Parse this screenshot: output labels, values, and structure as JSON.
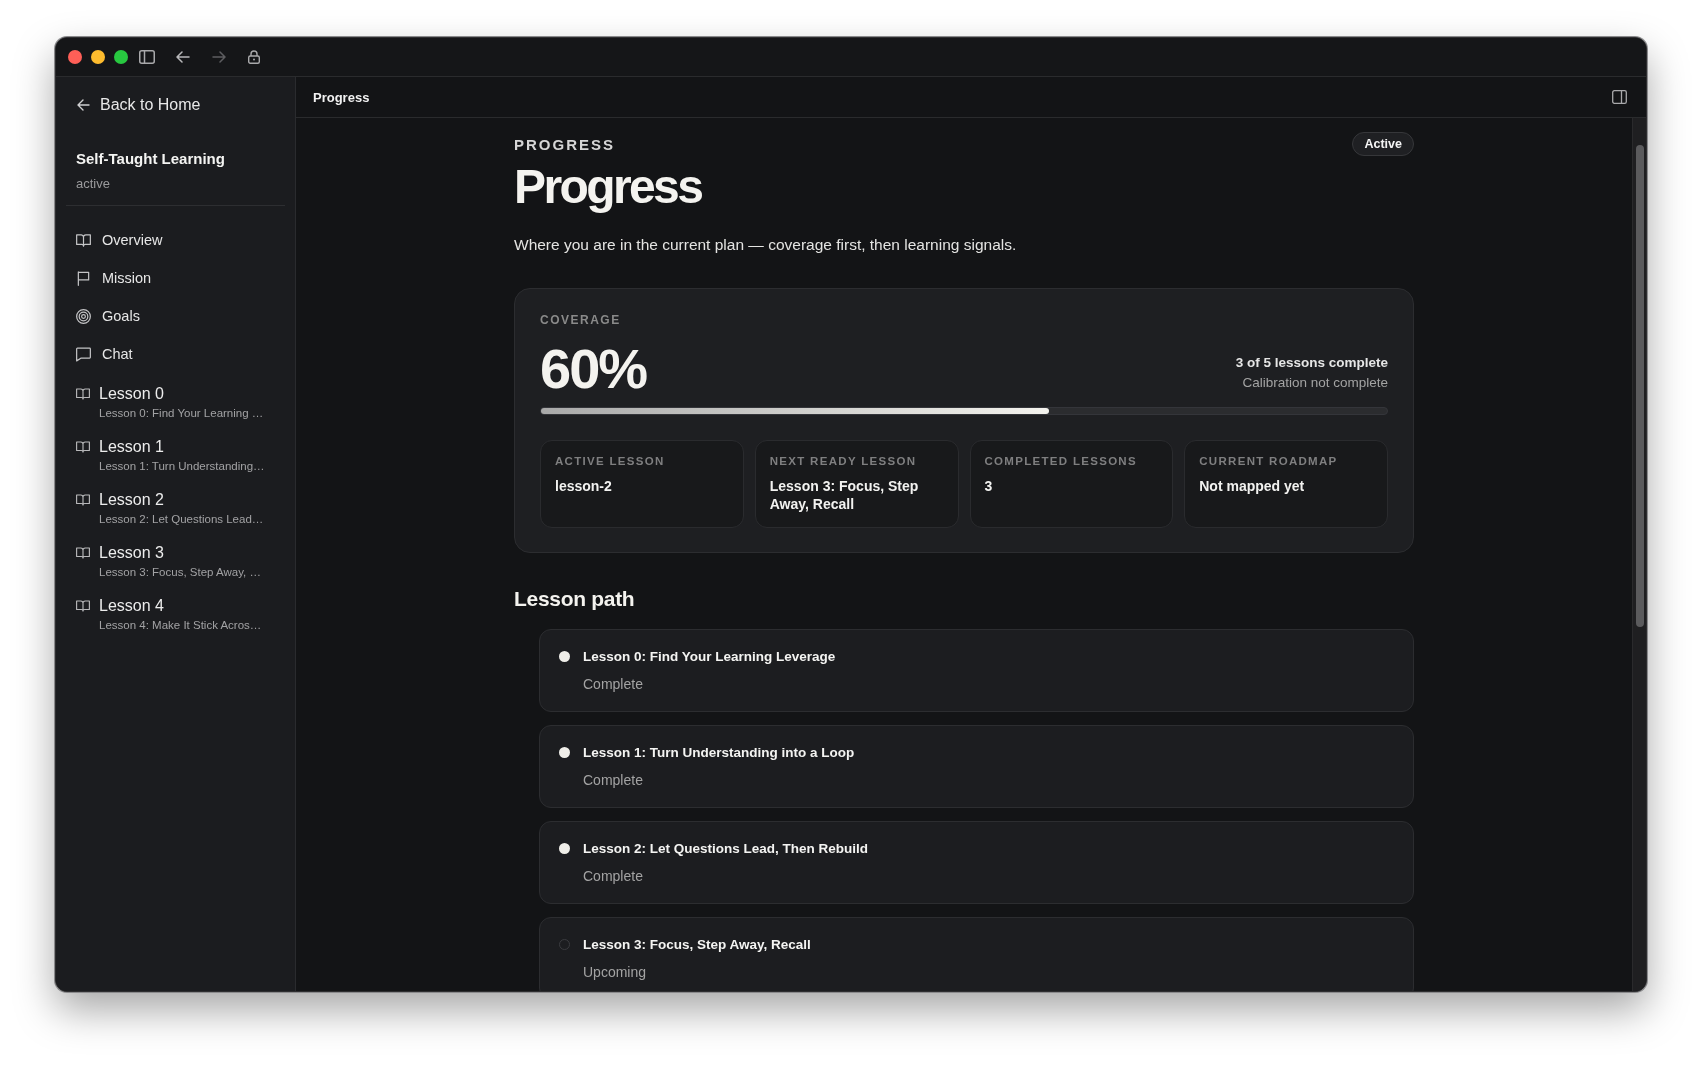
{
  "sidebar": {
    "back_link": "Back to Home",
    "project": {
      "title": "Self-Taught Learning",
      "status": "active"
    },
    "nav_items": [
      {
        "label": "Overview",
        "kind": "overview"
      },
      {
        "label": "Mission",
        "kind": "mission"
      },
      {
        "label": "Goals",
        "kind": "goals"
      },
      {
        "label": "Chat",
        "kind": "chat"
      }
    ],
    "lessons": [
      {
        "title": "Lesson 0",
        "subtitle": "Lesson 0: Find Your Learning …"
      },
      {
        "title": "Lesson 1",
        "subtitle": "Lesson 1: Turn Understanding…"
      },
      {
        "title": "Lesson 2",
        "subtitle": "Lesson 2: Let Questions Lead…"
      },
      {
        "title": "Lesson 3",
        "subtitle": "Lesson 3: Focus, Step Away, …"
      },
      {
        "title": "Lesson 4",
        "subtitle": "Lesson 4: Make It Stick Acros…"
      }
    ]
  },
  "header": {
    "title": "Progress"
  },
  "page": {
    "eyebrow": "PROGRESS",
    "badge": "Active",
    "title": "Progress",
    "description": "Where you are in the current plan — coverage first, then learning signals."
  },
  "coverage": {
    "label": "COVERAGE",
    "value": "60%",
    "summary": "3 of 5 lessons complete",
    "note": "Calibration not complete",
    "level": 0.6,
    "stats": [
      {
        "label": "ACTIVE LESSON",
        "value": "lesson-2"
      },
      {
        "label": "NEXT READY LESSON",
        "value": "Lesson 3: Focus, Step Away, Recall"
      },
      {
        "label": "COMPLETED LESSONS",
        "value": "3"
      },
      {
        "label": "CURRENT ROADMAP",
        "value": "Not mapped yet"
      }
    ]
  },
  "lesson_path": {
    "title": "Lesson path",
    "lessons": [
      {
        "title": "Lesson 0: Find Your Learning Leverage",
        "status": "Complete",
        "complete": true
      },
      {
        "title": "Lesson 1: Turn Understanding into a Loop",
        "status": "Complete",
        "complete": true
      },
      {
        "title": "Lesson 2: Let Questions Lead, Then Rebuild",
        "status": "Complete",
        "complete": true
      },
      {
        "title": "Lesson 3: Focus, Step Away, Recall",
        "status": "Upcoming",
        "complete": false
      }
    ]
  }
}
